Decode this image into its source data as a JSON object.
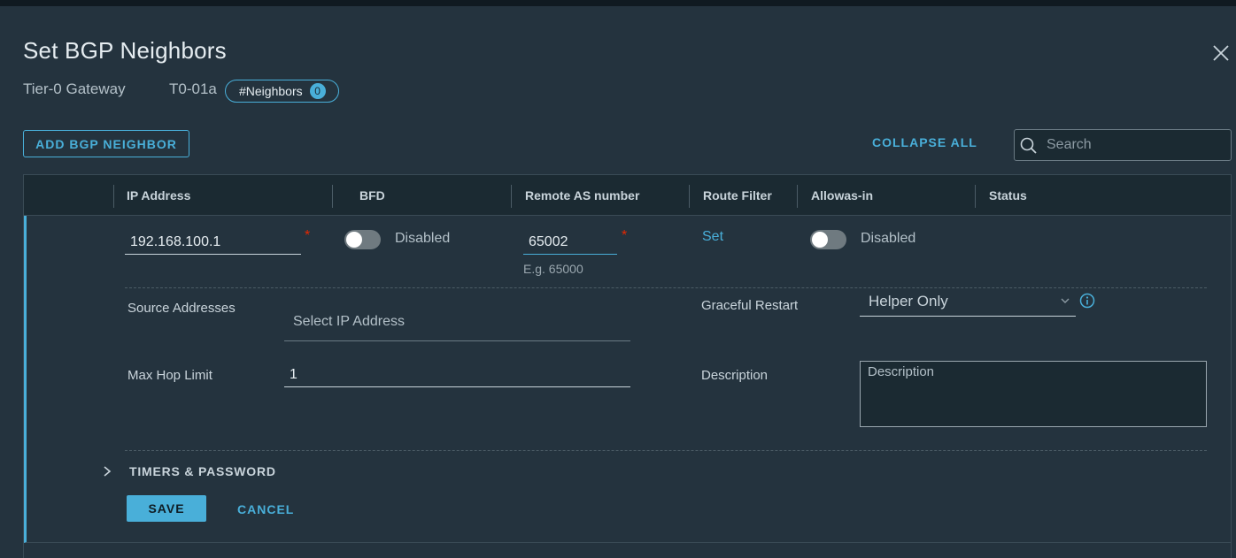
{
  "dialog": {
    "title": "Set BGP Neighbors",
    "gateway_type_label": "Tier-0 Gateway",
    "gateway_name": "T0-01a",
    "neighbors_badge_label": "#Neighbors",
    "neighbors_count": "0"
  },
  "toolbar": {
    "add_button_label": "ADD BGP NEIGHBOR",
    "collapse_all_label": "COLLAPSE ALL",
    "search_placeholder": "Search"
  },
  "table": {
    "columns": [
      "IP Address",
      "BFD",
      "Remote AS number",
      "Route Filter",
      "Allowas-in",
      "Status"
    ]
  },
  "neighbor": {
    "ip_address": "192.168.100.1",
    "bfd_state": "Disabled",
    "remote_as": "65002",
    "remote_as_hint": "E.g. 65000",
    "route_filter_link": "Set",
    "allowas_in_state": "Disabled",
    "source_addresses_label": "Source Addresses",
    "source_addresses_placeholder": "Select IP Address",
    "max_hop_label": "Max Hop Limit",
    "max_hop_value": "1",
    "graceful_restart_label": "Graceful Restart",
    "graceful_restart_value": "Helper Only",
    "description_label": "Description",
    "description_placeholder": "Description",
    "timers_label": "TIMERS & PASSWORD",
    "save_label": "SAVE",
    "cancel_label": "CANCEL"
  },
  "colors": {
    "accent": "#49afd9",
    "background": "#24333e",
    "header_background": "#1b2a32",
    "required": "#e62700"
  }
}
